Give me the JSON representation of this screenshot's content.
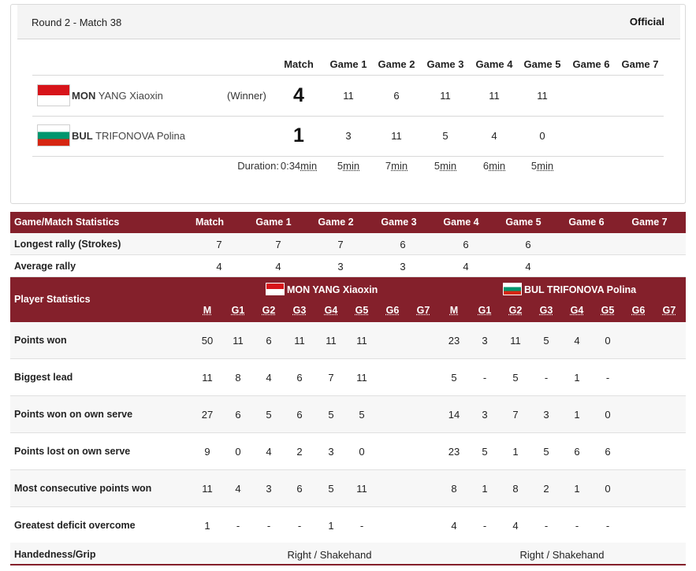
{
  "header": {
    "round": "Round 2  - Match 38",
    "status": "Official"
  },
  "score": {
    "columns": [
      "Match",
      "Game 1",
      "Game 2",
      "Game 3",
      "Game 4",
      "Game 5",
      "Game 6",
      "Game 7"
    ],
    "players": [
      {
        "code": "MON",
        "name": "YANG Xiaoxin",
        "result": "(Winner)",
        "match": "4",
        "games": [
          "11",
          "6",
          "11",
          "11",
          "11",
          "",
          ""
        ],
        "flag_colors": [
          "#d7141a",
          "#ffffff"
        ]
      },
      {
        "code": "BUL",
        "name": "TRIFONOVA Polina",
        "result": "",
        "match": "1",
        "games": [
          "3",
          "11",
          "5",
          "4",
          "0",
          "",
          ""
        ],
        "flag_colors": [
          "#ffffff",
          "#00966e",
          "#d62612"
        ]
      }
    ],
    "duration": {
      "label": "Duration:",
      "match": "0:34",
      "games": [
        "5",
        "7",
        "5",
        "6",
        "5"
      ],
      "unit": "min"
    }
  },
  "game_stats": {
    "header": [
      "Game/Match Statistics",
      "Match",
      "Game 1",
      "Game 2",
      "Game 3",
      "Game 4",
      "Game 5",
      "Game 6",
      "Game 7"
    ],
    "rows": [
      {
        "label": "Longest rally (Strokes)",
        "values": [
          "7",
          "7",
          "7",
          "6",
          "6",
          "6",
          "",
          ""
        ]
      },
      {
        "label": "Average rally",
        "values": [
          "4",
          "4",
          "3",
          "3",
          "4",
          "4",
          "",
          ""
        ]
      }
    ]
  },
  "player_stats": {
    "title": "Player Statistics",
    "player1": "MON YANG Xiaoxin",
    "player2": "BUL TRIFONOVA Polina",
    "sub_columns": [
      "M",
      "G1",
      "G2",
      "G3",
      "G4",
      "G5",
      "G6",
      "G7"
    ],
    "rows": [
      {
        "label": "Points won",
        "p1": [
          "50",
          "11",
          "6",
          "11",
          "11",
          "11",
          "",
          ""
        ],
        "p2": [
          "23",
          "3",
          "11",
          "5",
          "4",
          "0",
          "",
          ""
        ]
      },
      {
        "label": "Biggest lead",
        "p1": [
          "11",
          "8",
          "4",
          "6",
          "7",
          "11",
          "",
          ""
        ],
        "p2": [
          "5",
          "-",
          "5",
          "-",
          "1",
          "-",
          "",
          ""
        ]
      },
      {
        "label": "Points won on own serve",
        "p1": [
          "27",
          "6",
          "5",
          "6",
          "5",
          "5",
          "",
          ""
        ],
        "p2": [
          "14",
          "3",
          "7",
          "3",
          "1",
          "0",
          "",
          ""
        ]
      },
      {
        "label": "Points lost on own serve",
        "p1": [
          "9",
          "0",
          "4",
          "2",
          "3",
          "0",
          "",
          ""
        ],
        "p2": [
          "23",
          "5",
          "1",
          "5",
          "6",
          "6",
          "",
          ""
        ]
      },
      {
        "label": "Most consecutive points won",
        "p1": [
          "11",
          "4",
          "3",
          "6",
          "5",
          "11",
          "",
          ""
        ],
        "p2": [
          "8",
          "1",
          "8",
          "2",
          "1",
          "0",
          "",
          ""
        ]
      },
      {
        "label": "Greatest deficit overcome",
        "p1": [
          "1",
          "-",
          "-",
          "-",
          "1",
          "-",
          "",
          ""
        ],
        "p2": [
          "4",
          "-",
          "4",
          "-",
          "-",
          "-",
          "",
          ""
        ]
      }
    ],
    "handedness": {
      "label": "Handedness/Grip",
      "p1": "Right / Shakehand",
      "p2": "Right / Shakehand"
    }
  },
  "colors": {
    "accent": "#84202b",
    "row_alt": "#f7f7f7",
    "border": "#e0e0e0"
  }
}
